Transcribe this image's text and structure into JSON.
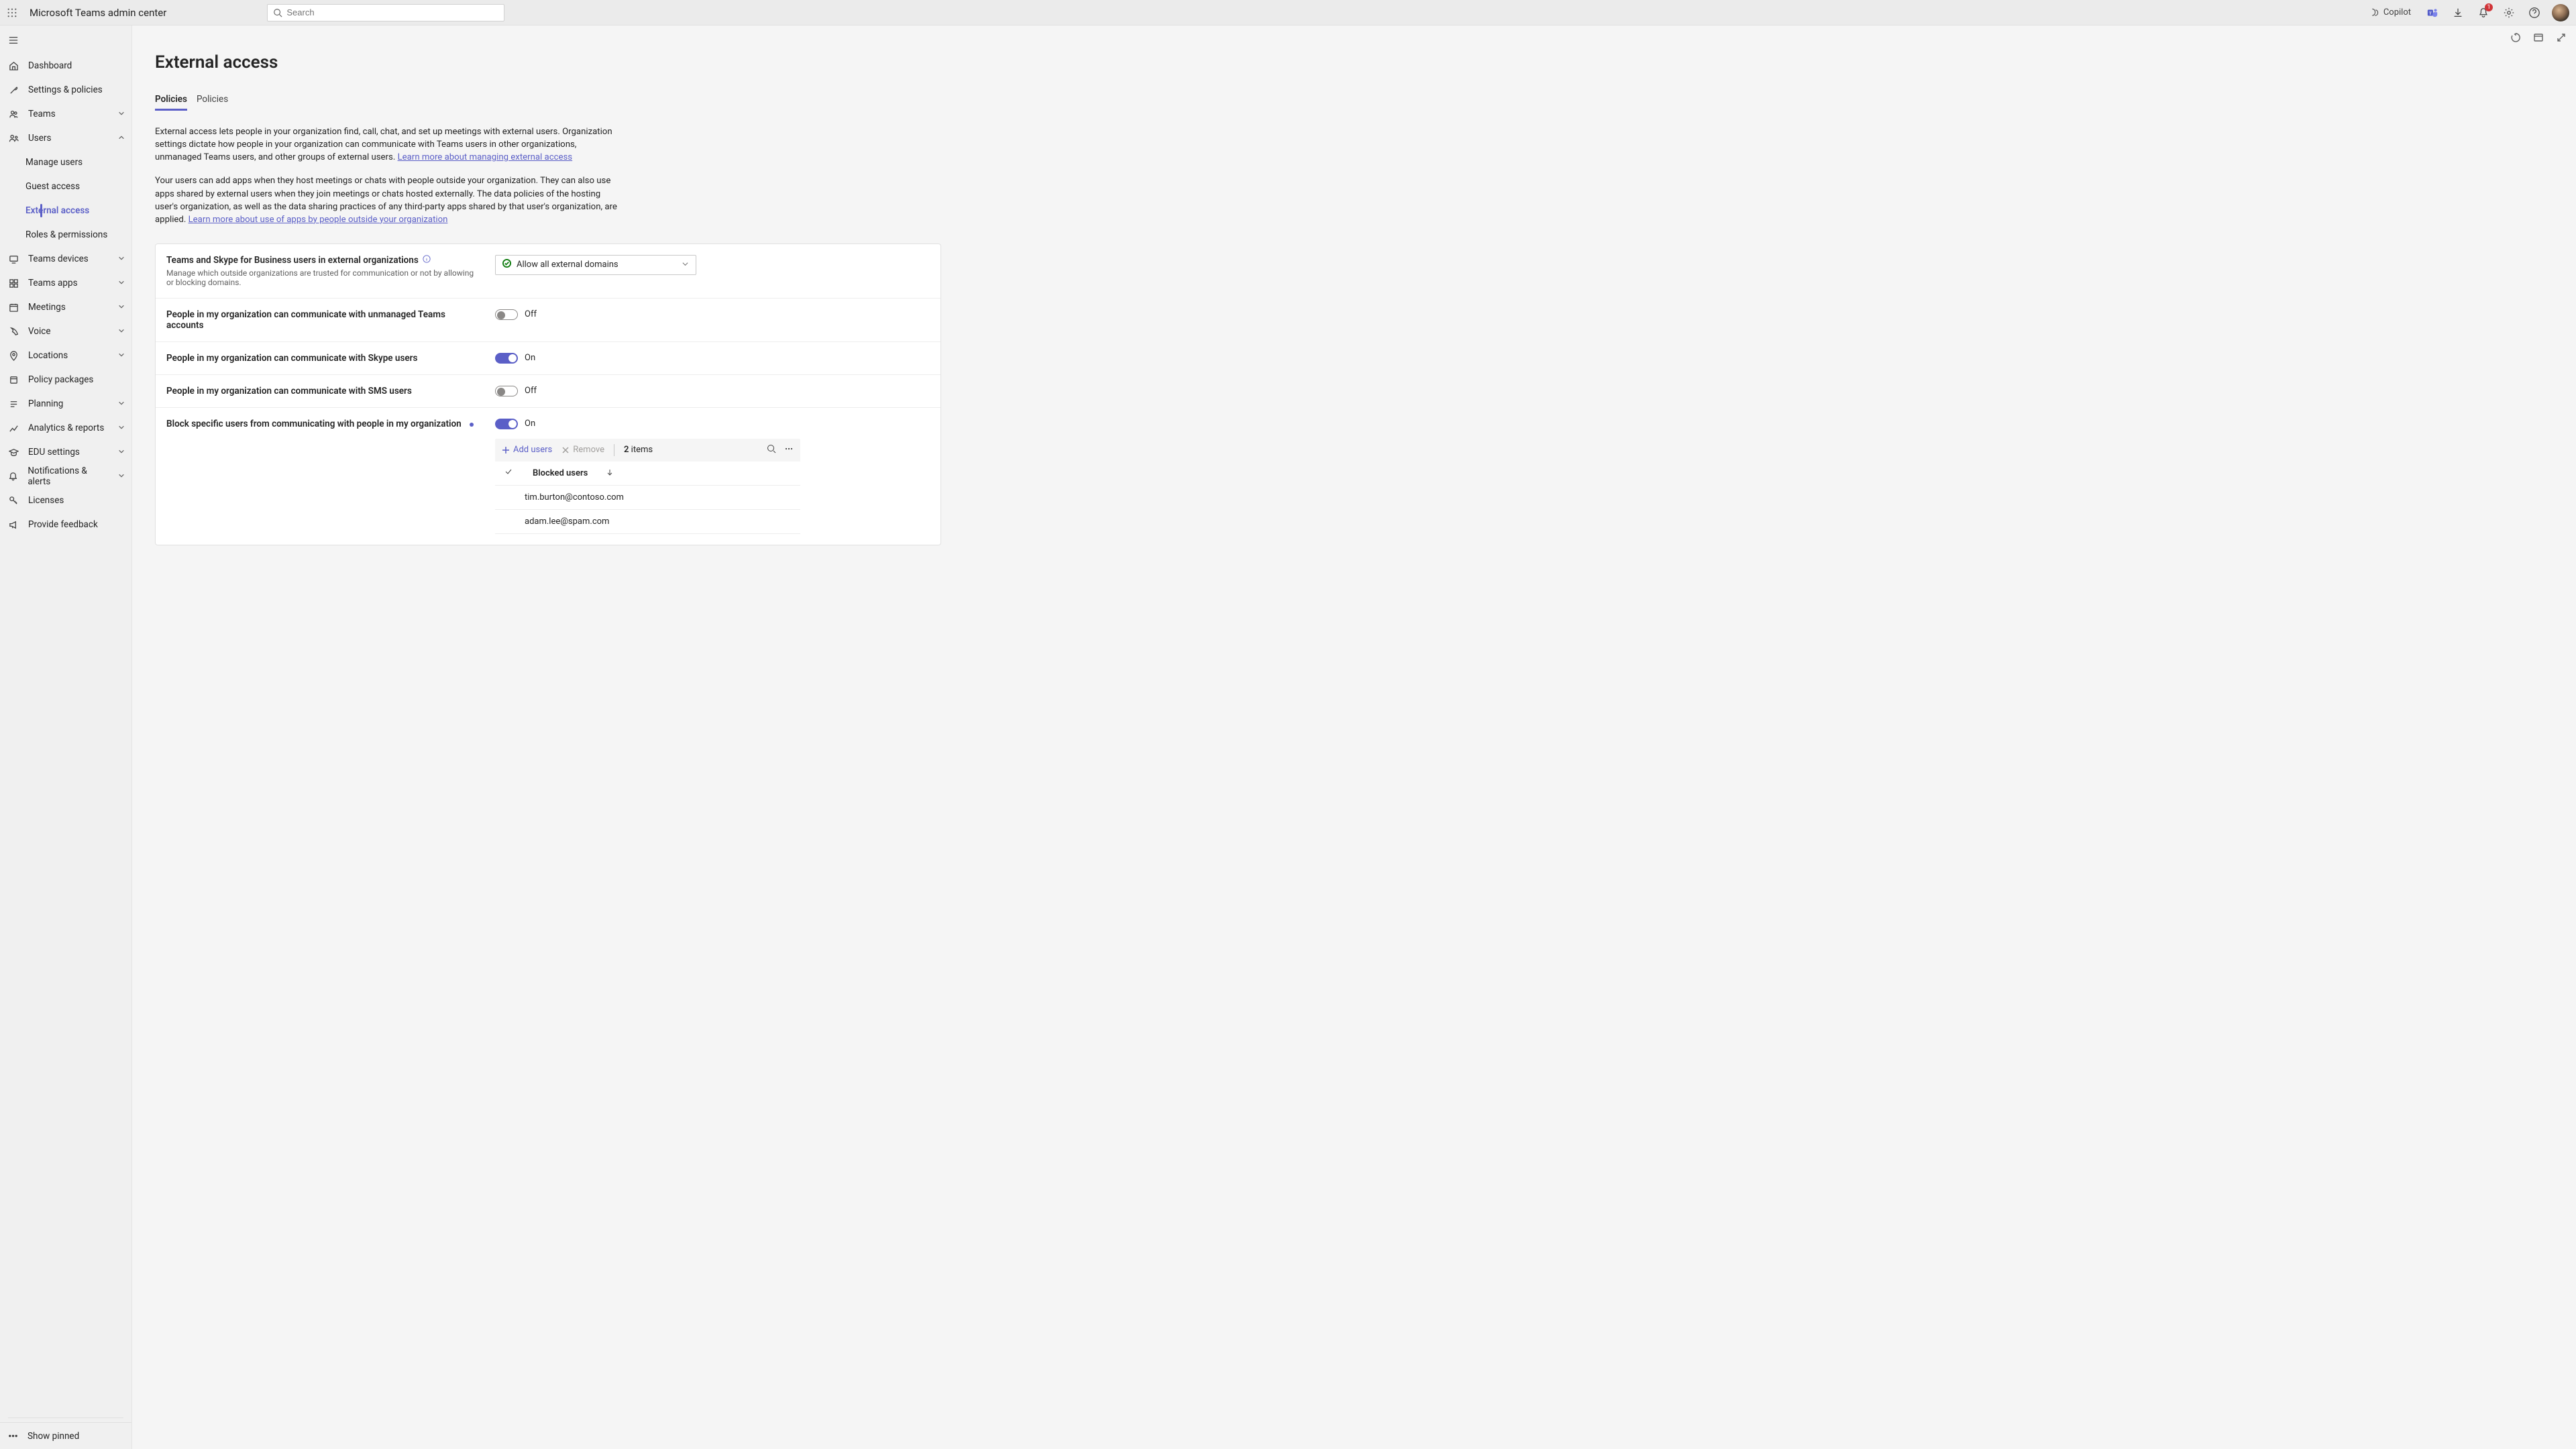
{
  "header": {
    "app_title": "Microsoft Teams admin center",
    "search_placeholder": "Search",
    "copilot_label": "Copilot",
    "notification_count": "1"
  },
  "sidebar": {
    "items": [
      {
        "label": "Dashboard"
      },
      {
        "label": "Settings & policies"
      },
      {
        "label": "Teams"
      },
      {
        "label": "Users"
      },
      {
        "label": "Teams devices"
      },
      {
        "label": "Teams apps"
      },
      {
        "label": "Meetings"
      },
      {
        "label": "Voice"
      },
      {
        "label": "Locations"
      },
      {
        "label": "Policy packages"
      },
      {
        "label": "Planning"
      },
      {
        "label": "Analytics & reports"
      },
      {
        "label": "EDU settings"
      },
      {
        "label": "Notifications & alerts"
      },
      {
        "label": "Licenses"
      },
      {
        "label": "Provide feedback"
      }
    ],
    "users_sub": [
      {
        "label": "Manage users"
      },
      {
        "label": "Guest access"
      },
      {
        "label": "External access"
      },
      {
        "label": "Roles & permissions"
      }
    ],
    "pinned": "Show pinned"
  },
  "page": {
    "title": "External access",
    "tabs": [
      "Policies",
      "Policies"
    ],
    "desc1_pre": "External access lets people in your organization find, call, chat, and set up meetings with external users. Organization settings dictate how people in your organization can communicate with Teams users in other organizations, unmanaged Teams users, and other groups of external users. ",
    "desc1_link": "Learn more about managing external access",
    "desc2_pre": "Your users can add apps when they host meetings or chats with people outside your organization. They can also use apps shared by external users when they join meetings or chats hosted externally. The data policies of the hosting user's organization, as well as the data sharing practices of any third-party apps shared by that user's organization, are applied. ",
    "desc2_link": "Learn more about use of apps by people outside your organization"
  },
  "settings": {
    "domain_title": "Teams and Skype for Business users in external organizations",
    "domain_sub": "Manage which outside organizations are trusted for communication or not by allowing or blocking domains.",
    "domain_value": "Allow all external domains",
    "unmanaged_title": "People in my organization can communicate with unmanaged Teams accounts",
    "skype_title": "People in my organization can communicate with Skype users",
    "sms_title": "People in my organization can communicate with SMS users",
    "block_title": "Block specific users from communicating with people in my organization",
    "state_on": "On",
    "state_off": "Off"
  },
  "blocked": {
    "add_label": "Add users",
    "remove_label": "Remove",
    "count_num": "2",
    "count_suffix": " items",
    "header": "Blocked users",
    "rows": [
      "tim.burton@contoso.com",
      "adam.lee@spam.com"
    ]
  }
}
